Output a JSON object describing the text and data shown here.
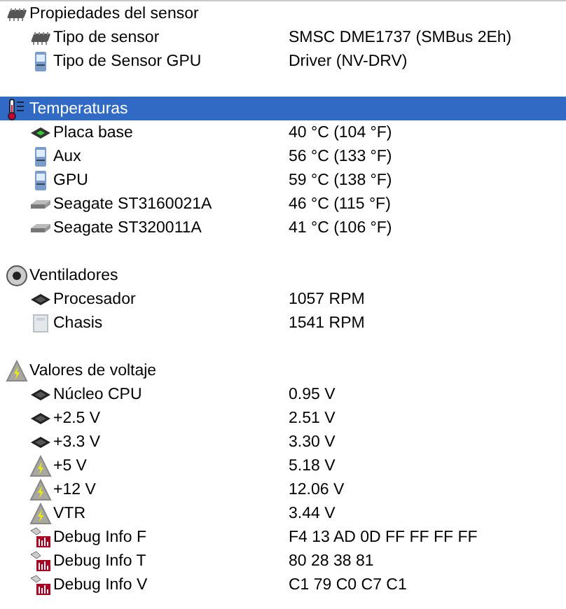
{
  "groups": [
    {
      "label": "Propiedades del sensor",
      "kind": "chip",
      "selected": false,
      "items": [
        {
          "label": "Tipo de sensor",
          "kind": "chip",
          "value": "SMSC DME1737  (SMBus 2Eh)",
          "selected": false
        },
        {
          "label": "Tipo de Sensor GPU",
          "kind": "monitor",
          "value": "Driver  (NV-DRV)",
          "selected": false
        }
      ]
    },
    {
      "label": "Temperaturas",
      "kind": "thermometer",
      "selected": true,
      "items": [
        {
          "label": "Placa base",
          "kind": "board",
          "value": "40 °C  (104 °F)",
          "selected": false
        },
        {
          "label": "Aux",
          "kind": "monitor",
          "value": "56 °C  (133 °F)",
          "selected": false
        },
        {
          "label": "GPU",
          "kind": "monitor",
          "value": "59 °C  (138 °F)",
          "selected": false
        },
        {
          "label": "Seagate ST3160021A",
          "kind": "disk",
          "value": "46 °C  (115 °F)",
          "selected": false
        },
        {
          "label": "Seagate ST320011A",
          "kind": "disk",
          "value": "41 °C  (106 °F)",
          "selected": false
        }
      ]
    },
    {
      "label": "Ventiladores",
      "kind": "fan",
      "selected": false,
      "items": [
        {
          "label": "Procesador",
          "kind": "cpu",
          "value": "1057 RPM",
          "selected": false
        },
        {
          "label": "Chasis",
          "kind": "case",
          "value": "1541 RPM",
          "selected": false
        }
      ]
    },
    {
      "label": "Valores de voltaje",
      "kind": "volt",
      "selected": false,
      "items": [
        {
          "label": "Núcleo CPU",
          "kind": "cpu",
          "value": "0.95 V",
          "selected": false
        },
        {
          "label": "+2.5 V",
          "kind": "cpu",
          "value": "2.51 V",
          "selected": false
        },
        {
          "label": "+3.3 V",
          "kind": "cpu",
          "value": "3.30 V",
          "selected": false
        },
        {
          "label": "+5 V",
          "kind": "volt",
          "value": "5.18 V",
          "selected": false
        },
        {
          "label": "+12 V",
          "kind": "volt",
          "value": "12.06 V",
          "selected": false
        },
        {
          "label": "VTR",
          "kind": "volt",
          "value": "3.44 V",
          "selected": false
        },
        {
          "label": "Debug Info F",
          "kind": "debug",
          "value": "F4 13 AD 0D FF FF FF FF",
          "selected": false
        },
        {
          "label": "Debug Info T",
          "kind": "debug",
          "value": "80 28 38 81",
          "selected": false
        },
        {
          "label": "Debug Info V",
          "kind": "debug",
          "value": "C1 79 C0 C7 C1",
          "selected": false
        }
      ]
    }
  ]
}
